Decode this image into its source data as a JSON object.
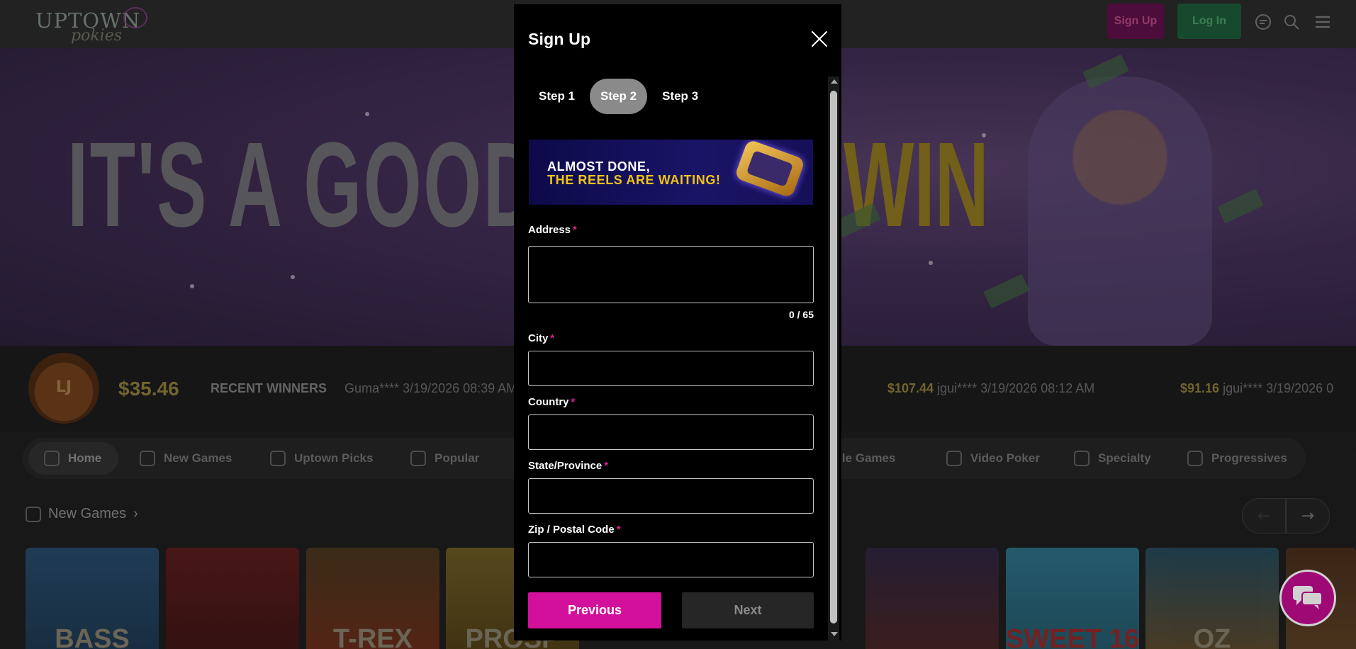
{
  "site": {
    "logo_text": "UPTOWN",
    "logo_sub": "pokies",
    "header": {
      "signup_label": "Sign Up",
      "login_label": "Log In"
    },
    "hero": {
      "text": "IT'S A GOOD",
      "text_right": "WIN"
    },
    "jackpot_badge": "LJ",
    "jackpot": "$35.46",
    "recent_winners_label": "RECENT WINNERS",
    "winners": [
      {
        "amount": "",
        "text": "Guma**** 3/19/2026 08:39 AM"
      },
      {
        "amount": "$107.44",
        "text": " jgui**** 3/19/2026 08:12 AM"
      },
      {
        "amount": "$91.16",
        "text": " jgui**** 3/19/2026 0"
      }
    ],
    "categories": [
      "Home",
      "New Games",
      "Uptown Picks",
      "Popular",
      "able Games",
      "Video Poker",
      "Specialty",
      "Progressives"
    ],
    "new_games_title": "New Games",
    "tiles": [
      "BASS",
      "",
      "T-REX",
      "PROSP",
      "",
      "",
      "",
      "",
      "SWEET 16",
      "OZ",
      ""
    ],
    "colors": {
      "accent": "#d3109b",
      "login_green": "#1c5a38",
      "gold": "#f1c418"
    }
  },
  "modal": {
    "title": "Sign Up",
    "steps": [
      {
        "label": "Step 1",
        "active": false
      },
      {
        "label": "Step 2",
        "active": true
      },
      {
        "label": "Step 3",
        "active": false
      }
    ],
    "banner": {
      "line1": "ALMOST DONE,",
      "line2": "THE REELS ARE WAITING!"
    },
    "fields": {
      "address": {
        "label": "Address",
        "value": "",
        "counter": "0 / 65"
      },
      "city": {
        "label": "City",
        "value": ""
      },
      "country": {
        "label": "Country",
        "value": ""
      },
      "state": {
        "label": "State/Province",
        "value": ""
      },
      "zip": {
        "label": "Zip / Postal Code",
        "value": ""
      }
    },
    "required_mark": "*",
    "previous_label": "Previous",
    "next_label": "Next"
  }
}
